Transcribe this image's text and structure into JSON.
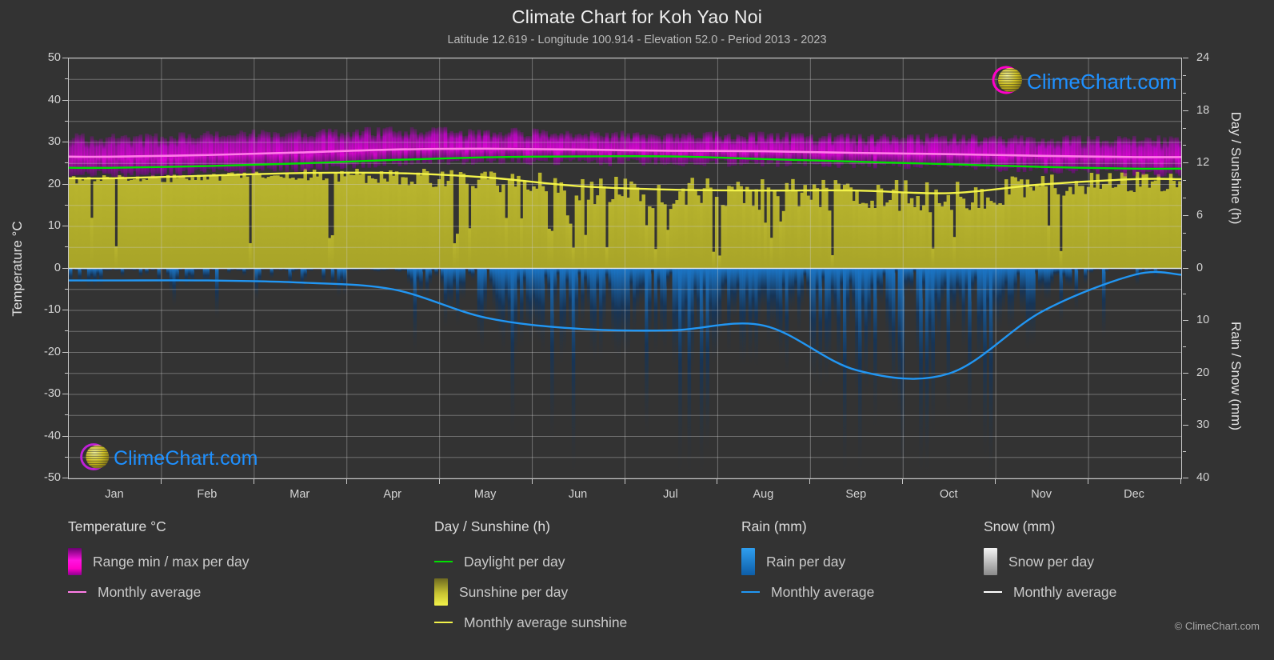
{
  "header": {
    "title": "Climate Chart for Koh Yao Noi",
    "subtitle": "Latitude 12.619 - Longitude 100.914 - Elevation 52.0 - Period 2013 - 2023"
  },
  "branding": {
    "wordmark": "ClimeChart.com",
    "copyright": "© ClimeChart.com"
  },
  "axes": {
    "left_title": "Temperature °C",
    "right_top_title": "Day / Sunshine (h)",
    "right_bottom_title": "Rain / Snow (mm)"
  },
  "legend": {
    "temperature": {
      "heading": "Temperature °C",
      "items": [
        {
          "label": "Range min / max per day",
          "type": "box",
          "color": "#ff00d0"
        },
        {
          "label": "Monthly average",
          "type": "line",
          "color": "#ff7de8"
        }
      ]
    },
    "day_sunshine": {
      "heading": "Day / Sunshine (h)",
      "items": [
        {
          "label": "Daylight per day",
          "type": "line",
          "color": "#00e000"
        },
        {
          "label": "Sunshine per day",
          "type": "box",
          "color": "#e8e83c"
        },
        {
          "label": "Monthly average sunshine",
          "type": "line",
          "color": "#f2f24a"
        }
      ]
    },
    "rain": {
      "heading": "Rain (mm)",
      "items": [
        {
          "label": "Rain per day",
          "type": "box",
          "color": "#1e8fe0"
        },
        {
          "label": "Monthly average",
          "type": "line",
          "color": "#2196f3"
        }
      ]
    },
    "snow": {
      "heading": "Snow (mm)",
      "items": [
        {
          "label": "Snow per day",
          "type": "box",
          "color": "#e8e8e8"
        },
        {
          "label": "Monthly average",
          "type": "line",
          "color": "#ffffff"
        }
      ]
    }
  },
  "chart_data": {
    "type": "area",
    "title": "Climate Chart for Koh Yao Noi",
    "subtitle": "Latitude 12.619 - Longitude 100.914 - Elevation 52.0 - Period 2013 - 2023",
    "xlabel": "",
    "x_tick_labels": [
      "Jan",
      "Feb",
      "Mar",
      "Apr",
      "May",
      "Jun",
      "Jul",
      "Aug",
      "Sep",
      "Oct",
      "Nov",
      "Dec"
    ],
    "grid": true,
    "legend_position": "below",
    "axes": {
      "temperature": {
        "label": "Temperature °C",
        "min": -50,
        "max": 50,
        "ticks": [
          50,
          40,
          30,
          20,
          10,
          0,
          -10,
          -20,
          -30,
          -40,
          -50
        ],
        "minor_step": 5
      },
      "day_sunshine": {
        "label": "Day / Sunshine (h)",
        "min": 0,
        "max": 24,
        "ticks": [
          24,
          18,
          12,
          6,
          0
        ],
        "maps_to_temperature": [
          0,
          50
        ]
      },
      "rain_snow": {
        "label": "Rain / Snow (mm)",
        "min": 0,
        "max": 40,
        "inverted": true,
        "ticks": [
          0,
          10,
          20,
          30,
          40
        ],
        "maps_to_temperature": [
          0,
          -50
        ]
      }
    },
    "series": [
      {
        "name": "Monthly average temperature",
        "unit": "°C",
        "color": "#ff7de8",
        "axis": "temperature",
        "values": [
          26.6,
          27.0,
          27.6,
          28.3,
          28.5,
          28.3,
          28.0,
          27.9,
          27.5,
          27.2,
          26.8,
          26.5
        ]
      },
      {
        "name": "Daily max temperature (range top)",
        "unit": "°C",
        "color": "#ff00d0",
        "axis": "temperature",
        "values": [
          31.0,
          31.6,
          32.2,
          32.6,
          32.4,
          32.0,
          31.6,
          31.4,
          31.2,
          31.0,
          30.8,
          30.6
        ]
      },
      {
        "name": "Daily min temperature (range bottom)",
        "unit": "°C",
        "color": "#ff00d0",
        "axis": "temperature",
        "values": [
          22.4,
          23.0,
          24.0,
          25.2,
          25.6,
          25.4,
          25.2,
          25.1,
          24.8,
          24.4,
          23.6,
          22.8
        ]
      },
      {
        "name": "Daylight per day",
        "unit": "h",
        "color": "#00e000",
        "axis": "day_sunshine",
        "values": [
          11.5,
          11.7,
          12.0,
          12.4,
          12.7,
          12.8,
          12.8,
          12.5,
          12.2,
          11.9,
          11.6,
          11.4
        ]
      },
      {
        "name": "Monthly average sunshine",
        "unit": "h",
        "color": "#f2f24a",
        "axis": "day_sunshine",
        "values": [
          10.3,
          10.6,
          10.9,
          10.9,
          10.4,
          9.4,
          9.0,
          8.9,
          8.9,
          8.6,
          9.6,
          10.2
        ]
      },
      {
        "name": "Monthly average rain",
        "unit": "mm",
        "color": "#2196f3",
        "axis": "rain_snow",
        "values": [
          2.3,
          2.3,
          2.7,
          4.0,
          9.4,
          11.5,
          11.8,
          10.9,
          19.4,
          20.0,
          8.2,
          1.2
        ]
      },
      {
        "name": "Monthly average snow",
        "unit": "mm",
        "color": "#ffffff",
        "axis": "rain_snow",
        "values": [
          0,
          0,
          0,
          0,
          0,
          0,
          0,
          0,
          0,
          0,
          0,
          0
        ]
      }
    ]
  }
}
